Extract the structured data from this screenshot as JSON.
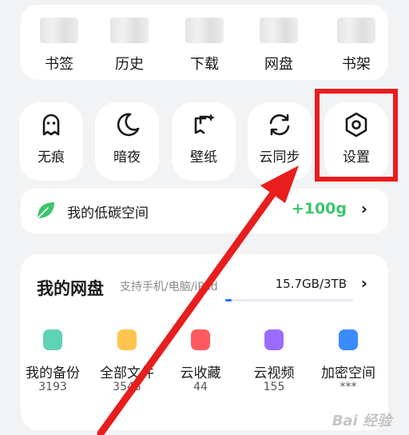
{
  "top_row": [
    {
      "label": "书签"
    },
    {
      "label": "历史"
    },
    {
      "label": "下载"
    },
    {
      "label": "网盘"
    },
    {
      "label": "书架"
    }
  ],
  "tools": [
    {
      "label": "无痕",
      "icon": "ghost-icon"
    },
    {
      "label": "暗夜",
      "icon": "moon-icon"
    },
    {
      "label": "壁纸",
      "icon": "wallpaper-icon"
    },
    {
      "label": "云同步",
      "icon": "sync-icon"
    },
    {
      "label": "设置",
      "icon": "settings-hexagon-icon"
    }
  ],
  "carbon": {
    "title": "我的低碳空间",
    "value": "+100g",
    "chevron": "›"
  },
  "disk": {
    "title": "我的网盘",
    "subtitle": "支持手机/电脑/iPad",
    "usage": "15.7GB/3TB",
    "chevron": "›",
    "progress_percent": 5,
    "items": [
      {
        "label": "我的备份",
        "count": "3193",
        "color": "#5fd3b5"
      },
      {
        "label": "全部文件",
        "count": "3543",
        "color": "#ffc44d"
      },
      {
        "label": "云收藏",
        "count": "44",
        "color": "#ff5a5f"
      },
      {
        "label": "云视频",
        "count": "155",
        "color": "#9b6bff"
      },
      {
        "label": "加密空间",
        "count": "***",
        "color": "#3a8bff"
      }
    ]
  },
  "watermark": "Bai 经验",
  "colors": {
    "highlight": "#e81d1d",
    "accent_green": "#3ec46d",
    "progress_blue": "#2f6bff"
  }
}
